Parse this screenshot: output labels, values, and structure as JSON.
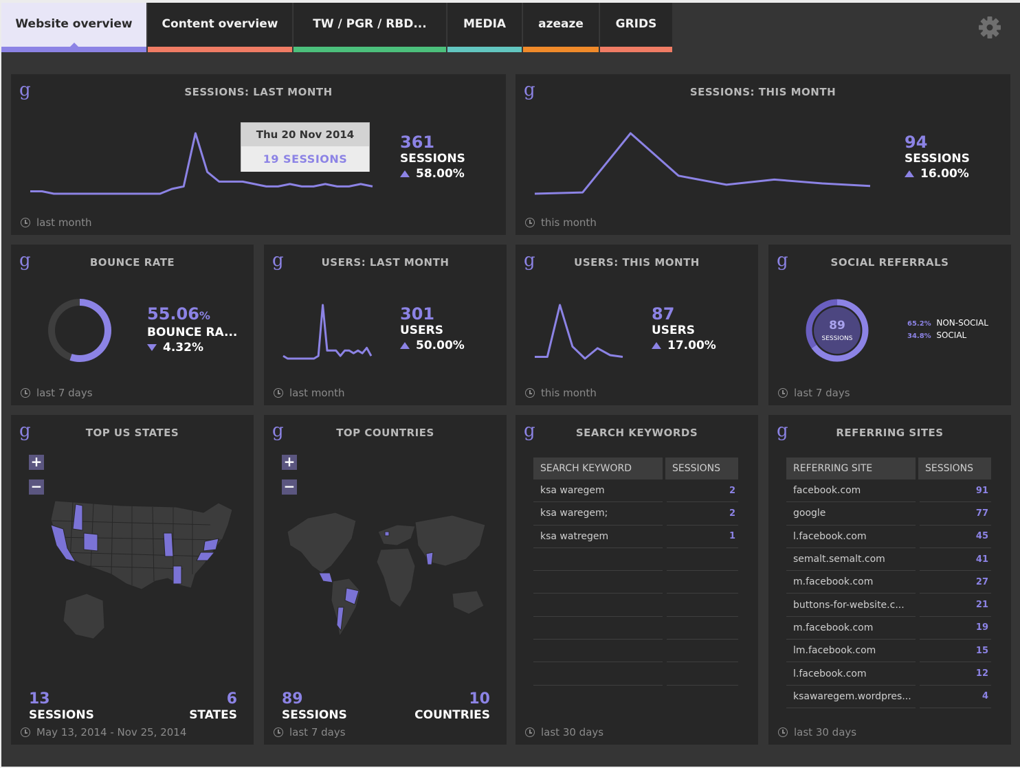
{
  "tabs": [
    {
      "label": "Website overview",
      "color": "#8c83e5",
      "active": true
    },
    {
      "label": "Content overview",
      "color": "#f07c64"
    },
    {
      "label": "TW / PGR / RBD...",
      "color": "#4cc07c"
    },
    {
      "label": "MEDIA",
      "color": "#62c6c0"
    },
    {
      "label": "azeaze",
      "color": "#f08a2a"
    },
    {
      "label": "GRIDS",
      "color": "#f07c64"
    }
  ],
  "settings_icon": "gear-icon",
  "accent": "#8c83e5",
  "widgets": {
    "sessions_last_month": {
      "title": "SESSIONS: LAST MONTH",
      "value": "361",
      "label": "SESSIONS",
      "delta": "58.00%",
      "delta_dir": "up",
      "period": "last month",
      "tooltip": {
        "date": "Thu 20 Nov 2014",
        "value": "19 SESSIONS"
      }
    },
    "sessions_this_month": {
      "title": "SESSIONS: THIS MONTH",
      "value": "94",
      "label": "SESSIONS",
      "delta": "16.00%",
      "delta_dir": "up",
      "period": "this month"
    },
    "bounce_rate": {
      "title": "BOUNCE RATE",
      "value": "55.06",
      "unit": "%",
      "label": "BOUNCE RA...",
      "delta": "4.32%",
      "delta_dir": "down",
      "period": "last 7 days",
      "ring_fraction": 0.5506
    },
    "users_last_month": {
      "title": "USERS: LAST MONTH",
      "value": "301",
      "label": "USERS",
      "delta": "50.00%",
      "delta_dir": "up",
      "period": "last month"
    },
    "users_this_month": {
      "title": "USERS: THIS MONTH",
      "value": "87",
      "label": "USERS",
      "delta": "17.00%",
      "delta_dir": "up",
      "period": "this month"
    },
    "social_referrals": {
      "title": "SOCIAL REFERRALS",
      "value": "89",
      "label": "SESSIONS",
      "period": "last 7 days",
      "legend": [
        {
          "pct": "65.2%",
          "label": "NON-SOCIAL",
          "fraction": 0.652
        },
        {
          "pct": "34.8%",
          "label": "SOCIAL",
          "fraction": 0.348
        }
      ]
    },
    "top_us_states": {
      "title": "TOP US STATES",
      "sessions": "13",
      "sessions_label": "SESSIONS",
      "count": "6",
      "count_label": "STATES",
      "period": "May 13, 2014 - Nov 25, 2014",
      "zoom_in": "+",
      "zoom_out": "−"
    },
    "top_countries": {
      "title": "TOP COUNTRIES",
      "sessions": "89",
      "sessions_label": "SESSIONS",
      "count": "10",
      "count_label": "COUNTRIES",
      "period": "last 7 days",
      "zoom_in": "+",
      "zoom_out": "−"
    },
    "search_keywords": {
      "title": "SEARCH KEYWORDS",
      "col1": "SEARCH KEYWORD",
      "col2": "SESSIONS",
      "rows": [
        {
          "name": "ksa waregem",
          "value": "2"
        },
        {
          "name": "ksa waregem;",
          "value": "2"
        },
        {
          "name": "ksa watregem",
          "value": "1"
        },
        {
          "name": "",
          "value": ""
        },
        {
          "name": "",
          "value": ""
        },
        {
          "name": "",
          "value": ""
        },
        {
          "name": "",
          "value": ""
        },
        {
          "name": "",
          "value": ""
        },
        {
          "name": "",
          "value": ""
        }
      ],
      "period": "last 30 days"
    },
    "referring_sites": {
      "title": "REFERRING SITES",
      "col1": "REFERRING SITE",
      "col2": "SESSIONS",
      "rows": [
        {
          "name": "facebook.com",
          "value": "91"
        },
        {
          "name": "google",
          "value": "77"
        },
        {
          "name": "l.facebook.com",
          "value": "45"
        },
        {
          "name": "semalt.semalt.com",
          "value": "41"
        },
        {
          "name": "m.facebook.com",
          "value": "27"
        },
        {
          "name": "buttons-for-website.c...",
          "value": "21"
        },
        {
          "name": "m.facebook.com",
          "value": "19"
        },
        {
          "name": "lm.facebook.com",
          "value": "15"
        },
        {
          "name": "l.facebook.com",
          "value": "12"
        },
        {
          "name": "ksawaregem.wordpres...",
          "value": "4"
        }
      ],
      "period": "last 30 days"
    }
  },
  "chart_data": [
    {
      "type": "line",
      "name": "sessions_last_month",
      "x": [
        "1",
        "2",
        "3",
        "4",
        "5",
        "6",
        "7",
        "8",
        "9",
        "10",
        "11",
        "12",
        "13",
        "14",
        "15",
        "16",
        "17",
        "18",
        "19",
        "20",
        "21",
        "22",
        "23",
        "24",
        "25",
        "26",
        "27",
        "28",
        "29",
        "30"
      ],
      "values": [
        4,
        4,
        3,
        3,
        3,
        3,
        3,
        3,
        3,
        3,
        3,
        3,
        5,
        6,
        28,
        12,
        8,
        8,
        8,
        7,
        6,
        6,
        7,
        6,
        6,
        7,
        6,
        6,
        7,
        6
      ]
    },
    {
      "type": "line",
      "name": "sessions_this_month",
      "values": [
        8,
        9,
        55,
        22,
        15,
        19,
        16,
        14
      ]
    },
    {
      "type": "line",
      "name": "users_last_month",
      "values": [
        1,
        0,
        0,
        0,
        0,
        0,
        0,
        0,
        1,
        20,
        3,
        3,
        3,
        1,
        3,
        3,
        2,
        3,
        2,
        4,
        1
      ]
    },
    {
      "type": "line",
      "name": "users_this_month",
      "values": [
        2,
        2,
        32,
        8,
        1,
        7,
        3,
        2
      ]
    },
    {
      "type": "pie",
      "name": "social_referrals",
      "categories": [
        "NON-SOCIAL",
        "SOCIAL"
      ],
      "values": [
        65.2,
        34.8
      ]
    }
  ]
}
